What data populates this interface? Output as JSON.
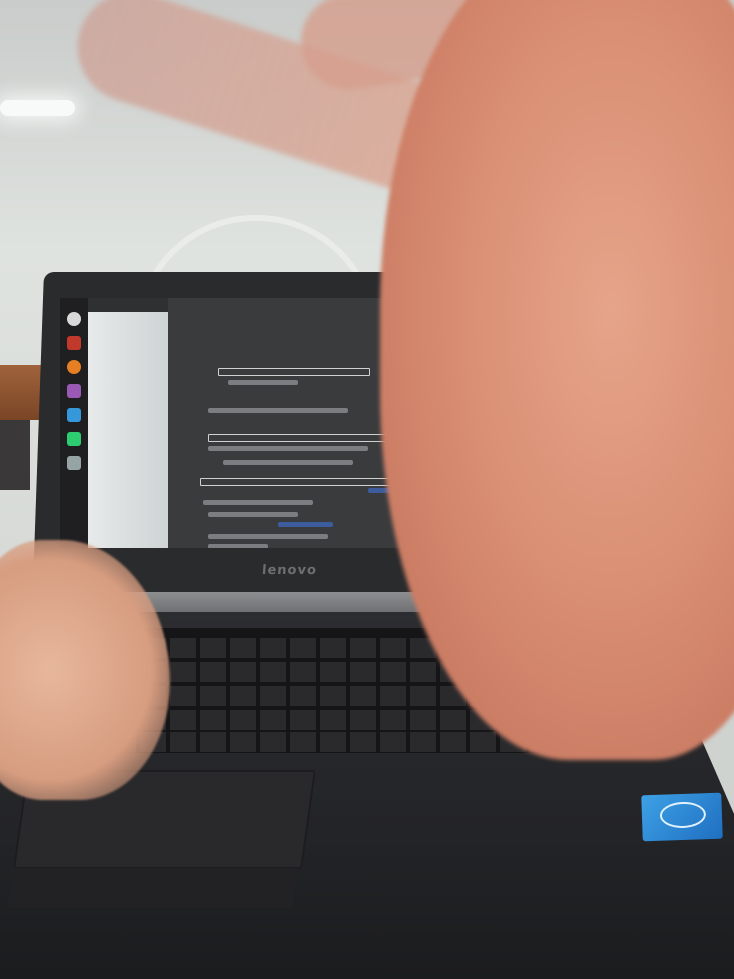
{
  "photo": {
    "subject": "",
    "laptop": {
      "brand_label": "lenovo"
    }
  }
}
